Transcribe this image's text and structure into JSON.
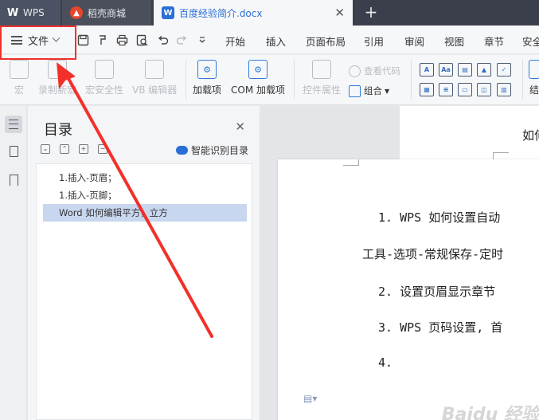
{
  "tabs": {
    "wps": "WPS",
    "shop": "稻壳商城",
    "doc": "百度经验简介.docx",
    "close": "✕",
    "add": "+"
  },
  "menubar": {
    "file": "文件",
    "items": [
      "开始",
      "插入",
      "页面布局",
      "引用",
      "审阅",
      "视图",
      "章节",
      "安全"
    ]
  },
  "ribbon": {
    "macro": "宏",
    "record_macro": "录制新宏",
    "macro_security": "宏安全性",
    "vb_editor": "VB 编辑器",
    "addins": "加载项",
    "com_addins": "COM 加载项",
    "control_props": "控件属性",
    "view_code": "查看代码",
    "group": "组合",
    "cut_label": "结"
  },
  "toc": {
    "title": "目录",
    "close": "✕",
    "smart": "智能识别目录",
    "items": [
      "1.插入-页眉；",
      "1.插入-页脚；",
      "Word 如何编辑平方，立方"
    ]
  },
  "doc": {
    "back_fragment": "如何",
    "lines": [
      "1.  WPS 如何设置自动",
      "工具-选项-常规保存-定时",
      "2.  设置页眉显示章节",
      "3.  WPS 页码设置, 首",
      "4."
    ],
    "watermark": "Baidu 经验"
  },
  "colors": {
    "highlight": "#f2302a",
    "accent": "#2b6fd6",
    "selection": "#c8d7ef"
  }
}
